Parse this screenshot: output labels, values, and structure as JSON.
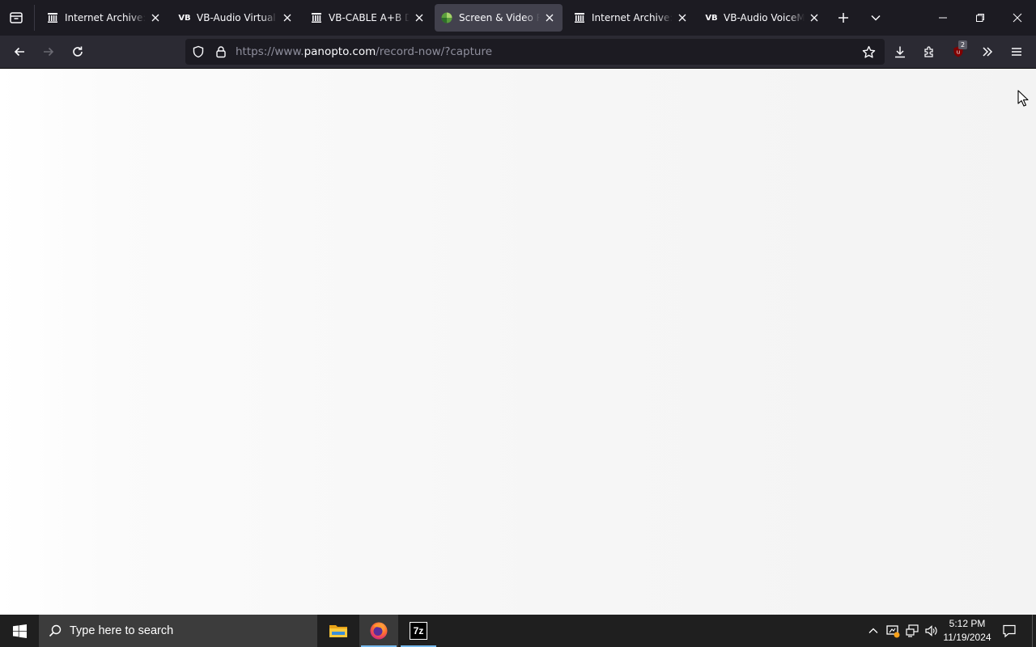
{
  "browser": {
    "tabs": [
      {
        "title": "Internet Archive: Vir",
        "favicon": "archive-icon",
        "active": false
      },
      {
        "title": "VB-Audio Virtual Ap",
        "favicon": "vb-icon",
        "active": false
      },
      {
        "title": "VB-CABLE A+B Driv",
        "favicon": "archive-icon",
        "active": false
      },
      {
        "title": "Screen & Video Rec",
        "favicon": "panopto-icon",
        "active": true
      },
      {
        "title": "Internet Archive: Vir",
        "favicon": "archive-icon",
        "active": false
      },
      {
        "title": "VB-Audio VoiceMe",
        "favicon": "vb-icon",
        "active": false
      }
    ],
    "vb_favicon_text": "VB",
    "url": {
      "prefix": "https://www.",
      "host": "panopto.com",
      "path": "/record-now/?capture"
    },
    "extension_badge": "2",
    "colors": {
      "tabbar_bg": "#1c1b22",
      "navbar_bg": "#2b2a33",
      "active_tab_bg": "#42414d",
      "page_bg": "#f4f4f4"
    }
  },
  "taskbar": {
    "search_placeholder": "Type here to search",
    "apps": [
      "file-explorer-icon",
      "firefox-icon",
      "7zip-icon"
    ],
    "sevenzip_label": "7z",
    "clock": {
      "time": "5:12 PM",
      "date": "11/19/2024"
    }
  }
}
